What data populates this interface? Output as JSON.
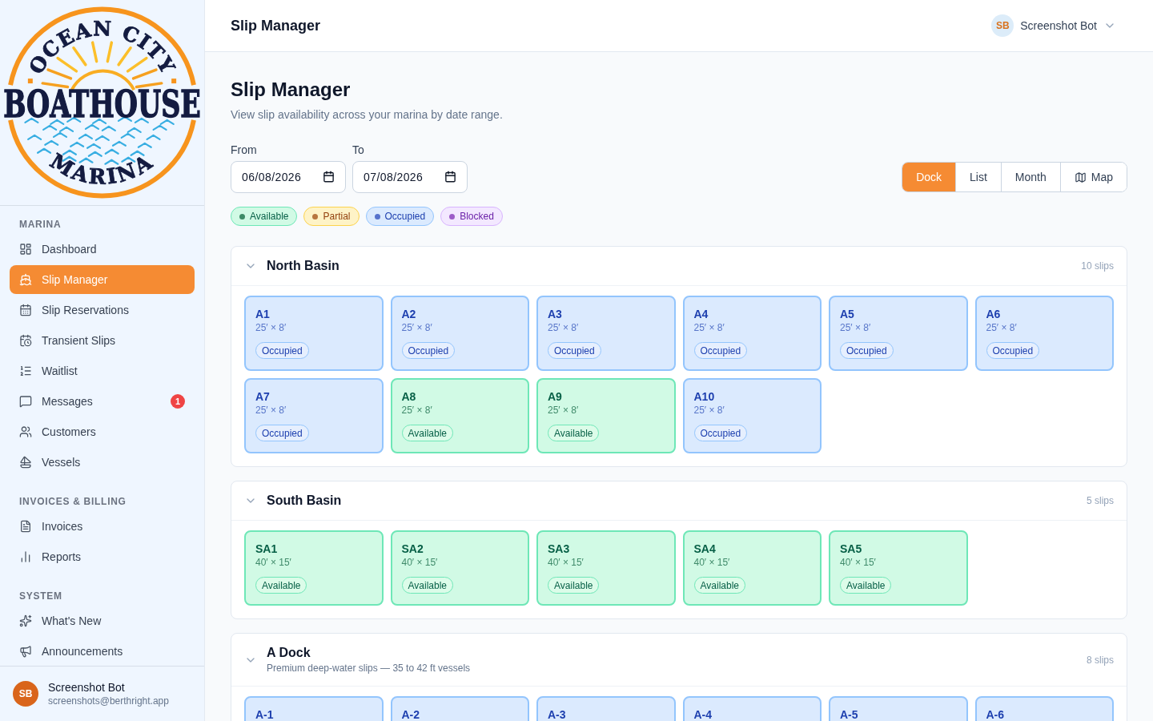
{
  "sidebar": {
    "logo": {
      "top_text": "OCEAN CITY",
      "main_text": "BOATHOUSE",
      "bottom_text": "MARINA"
    },
    "sections": [
      {
        "title": "MARINA",
        "items": [
          {
            "label": "Dashboard",
            "selected": false
          },
          {
            "label": "Slip Manager",
            "selected": true
          },
          {
            "label": "Slip Reservations",
            "selected": false
          },
          {
            "label": "Transient Slips",
            "selected": false
          },
          {
            "label": "Waitlist",
            "selected": false
          },
          {
            "label": "Messages",
            "selected": false,
            "badge": "1"
          },
          {
            "label": "Customers",
            "selected": false
          },
          {
            "label": "Vessels",
            "selected": false
          }
        ]
      },
      {
        "title": "INVOICES & BILLING",
        "items": [
          {
            "label": "Invoices",
            "selected": false
          },
          {
            "label": "Reports",
            "selected": false
          }
        ]
      },
      {
        "title": "SYSTEM",
        "items": [
          {
            "label": "What's New",
            "selected": false
          },
          {
            "label": "Announcements",
            "selected": false
          }
        ]
      }
    ],
    "user": {
      "initials": "SB",
      "name": "Screenshot Bot",
      "email": "screenshots@berthright.app"
    }
  },
  "header": {
    "title": "Slip Manager",
    "user": {
      "initials": "SB",
      "name": "Screenshot Bot"
    }
  },
  "page": {
    "title": "Slip Manager",
    "subtitle": "View slip availability across your marina by date range.",
    "date_range": {
      "from": {
        "label": "From",
        "value": "06/08/2026"
      },
      "to": {
        "label": "To",
        "value": "07/08/2026"
      }
    },
    "legend": [
      {
        "label": "Available",
        "kind": "available",
        "color": "#3d8b67"
      },
      {
        "label": "Partial",
        "kind": "partial",
        "color": "#b8763e"
      },
      {
        "label": "Occupied",
        "kind": "occupied",
        "color": "#5672cc"
      },
      {
        "label": "Blocked",
        "kind": "blocked",
        "color": "#9d5bc8"
      }
    ],
    "views": [
      {
        "label": "Dock",
        "selected": true
      },
      {
        "label": "List",
        "selected": false
      },
      {
        "label": "Month",
        "selected": false
      },
      {
        "label": "Map",
        "selected": false
      }
    ],
    "basins": [
      {
        "name": "North Basin",
        "count": "10 slips",
        "expanded": true,
        "slips": [
          {
            "name": "A1",
            "size": "25′ × 8′",
            "status": "Occupied",
            "kind": "occupied"
          },
          {
            "name": "A2",
            "size": "25′ × 8′",
            "status": "Occupied",
            "kind": "occupied"
          },
          {
            "name": "A3",
            "size": "25′ × 8′",
            "status": "Occupied",
            "kind": "occupied"
          },
          {
            "name": "A4",
            "size": "25′ × 8′",
            "status": "Occupied",
            "kind": "occupied"
          },
          {
            "name": "A5",
            "size": "25′ × 8′",
            "status": "Occupied",
            "kind": "occupied"
          },
          {
            "name": "A6",
            "size": "25′ × 8′",
            "status": "Occupied",
            "kind": "occupied"
          },
          {
            "name": "A7",
            "size": "25′ × 8′",
            "status": "Occupied",
            "kind": "occupied"
          },
          {
            "name": "A8",
            "size": "25′ × 8′",
            "status": "Available",
            "kind": "available"
          },
          {
            "name": "A9",
            "size": "25′ × 8′",
            "status": "Available",
            "kind": "available"
          },
          {
            "name": "A10",
            "size": "25′ × 8′",
            "status": "Occupied",
            "kind": "occupied"
          }
        ]
      },
      {
        "name": "South Basin",
        "count": "5 slips",
        "expanded": true,
        "slips": [
          {
            "name": "SA1",
            "size": "40′ × 15′",
            "status": "Available",
            "kind": "available"
          },
          {
            "name": "SA2",
            "size": "40′ × 15′",
            "status": "Available",
            "kind": "available"
          },
          {
            "name": "SA3",
            "size": "40′ × 15′",
            "status": "Available",
            "kind": "available"
          },
          {
            "name": "SA4",
            "size": "40′ × 15′",
            "status": "Available",
            "kind": "available"
          },
          {
            "name": "SA5",
            "size": "40′ × 15′",
            "status": "Available",
            "kind": "available"
          }
        ]
      },
      {
        "name": "A Dock",
        "description": "Premium deep-water slips — 35 to 42 ft vessels",
        "count": "8 slips",
        "expanded": true,
        "slips": [
          {
            "name": "A-1",
            "kind": "occupied"
          },
          {
            "name": "A-2",
            "kind": "occupied"
          },
          {
            "name": "A-3",
            "kind": "occupied"
          },
          {
            "name": "A-4",
            "kind": "occupied"
          },
          {
            "name": "A-5",
            "kind": "occupied"
          },
          {
            "name": "A-6",
            "kind": "occupied"
          }
        ]
      }
    ]
  }
}
